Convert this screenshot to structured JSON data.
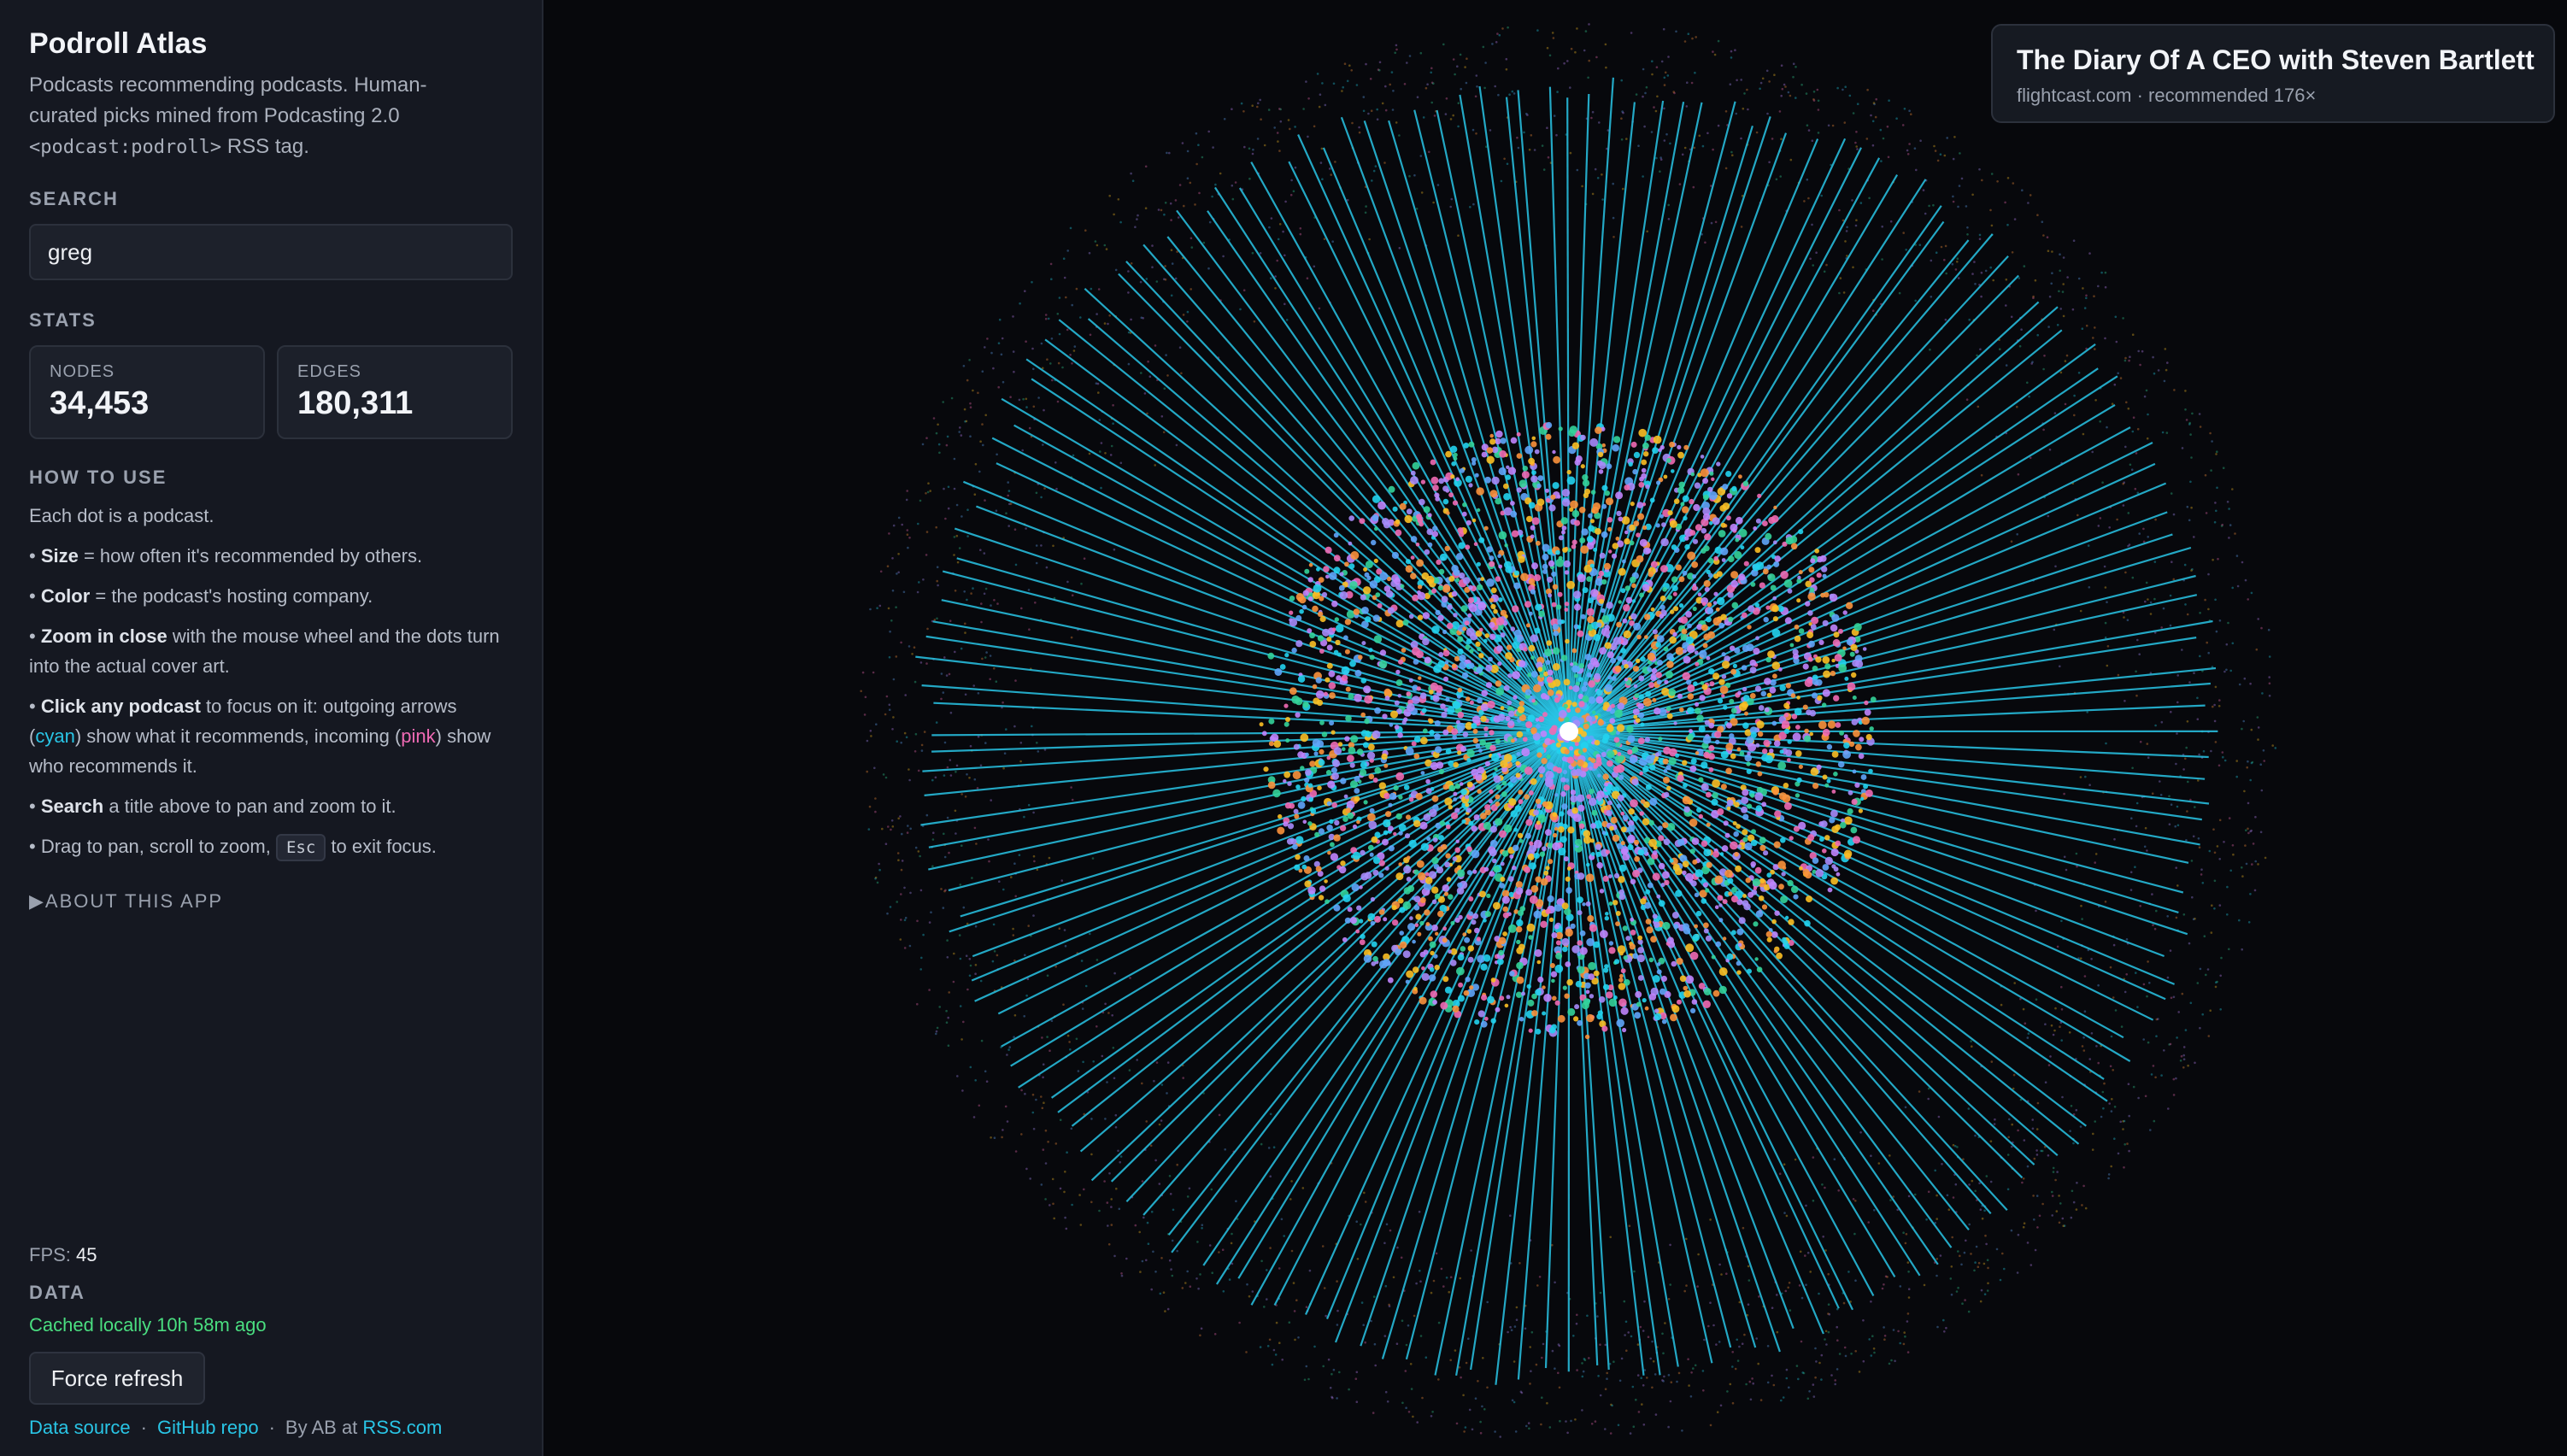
{
  "app": {
    "title": "Podroll Atlas",
    "subtitle_text": "Podcasts recommending podcasts. Human-curated picks mined from Podcasting 2.0",
    "subtitle_tag": "<podcast:podroll>",
    "subtitle_end": " RSS tag."
  },
  "search": {
    "label": "SEARCH",
    "value": "greg"
  },
  "stats": {
    "label": "STATS",
    "nodes_label": "NODES",
    "nodes_value": "34,453",
    "edges_label": "EDGES",
    "edges_value": "180,311"
  },
  "howto": {
    "label": "HOW TO USE",
    "intro": "Each dot is a podcast.",
    "size_b": "Size",
    "size_t": " = how often it's recommended by others.",
    "color_b": "Color",
    "color_t": " = the podcast's hosting company.",
    "zoom_b": "Zoom in close",
    "zoom_t": " with the mouse wheel and the dots turn into the actual cover art.",
    "click_b": "Click any podcast",
    "click_t1": " to focus on it: outgoing arrows (",
    "click_cyan": "cyan",
    "click_t2": ") show what it recommends, incoming (",
    "click_pink": "pink",
    "click_t3": ") show who recommends it.",
    "search_b": "Search",
    "search_t": " a title above to pan and zoom to it.",
    "drag_t1": "Drag to pan, scroll to zoom, ",
    "drag_key": "Esc",
    "drag_t2": " to exit focus."
  },
  "about": {
    "label": "ABOUT THIS APP"
  },
  "fps": {
    "label": "FPS: ",
    "value": "45"
  },
  "data": {
    "label": "DATA",
    "cached": "Cached locally 10h 58m ago",
    "refresh": "Force refresh"
  },
  "footer": {
    "data_source": "Data source",
    "github": "GitHub repo",
    "by": "By AB at ",
    "rss": "RSS.com"
  },
  "tooltip": {
    "title": "The Diary Of A CEO with Steven Bartlett",
    "subtitle": "flightcast.com · recommended 176×"
  },
  "colors": {
    "background": "#07080c",
    "sidebar": "#151821",
    "edge_out": "#29c5e6",
    "edge_in": "#f06ab4",
    "cached_status": "#4ade80",
    "node_palette": [
      "#f06ab4",
      "#fbbf24",
      "#a78bfa",
      "#34d399",
      "#60a5fa",
      "#fb923c",
      "#22d3ee",
      "#c084fc"
    ]
  }
}
